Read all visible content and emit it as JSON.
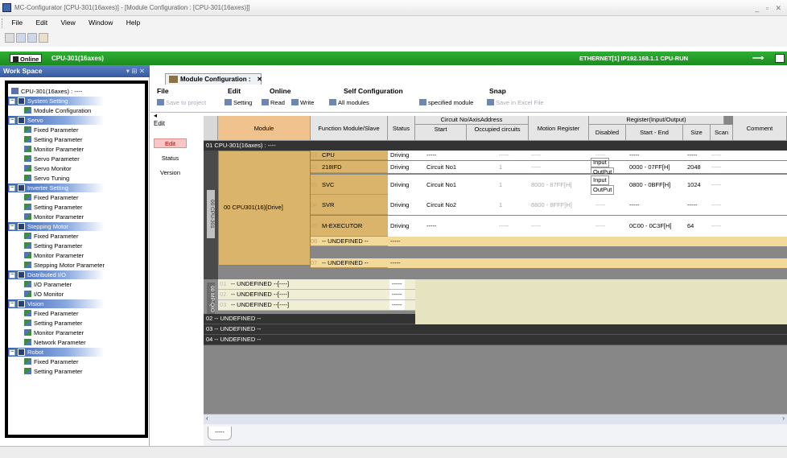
{
  "window": {
    "title": "MC-Configurator [CPU-301(16axes)] - [Module Configuration : [CPU-301(16axes)]]",
    "controls": "_ ▫ ✕"
  },
  "menu": [
    "File",
    "Edit",
    "View",
    "Window",
    "Help"
  ],
  "status_bar": {
    "online_label": "Online",
    "cpu_name": "CPU-301(16axes)",
    "connection": "ETHERNET[1] IP192.168.1.1 CPU-RUN"
  },
  "workspace": {
    "title": "Work Space",
    "pins": "▾ ⊞ ✕",
    "root": "CPU-301(16axes) : ----",
    "sections": [
      {
        "label": "System Setting",
        "items": [
          "Module Configuration"
        ]
      },
      {
        "label": "Servo",
        "items": [
          "Fixed Parameter",
          "Setting Parameter",
          "Monitor Parameter",
          "Servo Parameter",
          "Servo Monitor",
          "Servo Tuning"
        ]
      },
      {
        "label": "Inverter Setting",
        "items": [
          "Fixed Parameter",
          "Setting Parameter",
          "Monitor Parameter"
        ]
      },
      {
        "label": "Stepping Motor",
        "items": [
          "Fixed Parameter",
          "Setting Parameter",
          "Monitor Parameter",
          "Stepping Motor Parameter"
        ]
      },
      {
        "label": "Distributed I/O",
        "items": [
          "I/O Parameter",
          "I/O Monitor"
        ]
      },
      {
        "label": "Vision",
        "items": [
          "Fixed Parameter",
          "Setting Parameter",
          "Monitor Parameter",
          "Network Parameter"
        ]
      },
      {
        "label": "Robot",
        "items": [
          "Fixed Parameter",
          "Setting Parameter"
        ]
      }
    ]
  },
  "tab": {
    "label": "Module Configuration : [CPU-301(16axes)]"
  },
  "ribbon": {
    "groups": [
      {
        "title": "File",
        "buttons": [
          "Save to project"
        ]
      },
      {
        "title": "Edit",
        "buttons": [
          "Setting"
        ]
      },
      {
        "title": "Online",
        "buttons": [
          "Read",
          "Write"
        ]
      },
      {
        "title": "Self Configuration",
        "buttons": [
          "All modules",
          "specified module"
        ]
      },
      {
        "title": "Snap",
        "buttons": [
          "Save in Excel File"
        ]
      }
    ]
  },
  "left_nav": {
    "header": "Edit",
    "items": [
      "Edit",
      "Status",
      "Version"
    ]
  },
  "table": {
    "headers": {
      "module": "Module",
      "function": "Function Module/Slave",
      "status": "Status",
      "circuit": "Circuit No/AxisAddress",
      "circuit_start": "Start",
      "circuit_occupied": "Occupied circuits",
      "motion": "Motion Register",
      "register": "Register(Input/Output)",
      "reg_disabled": "Disabled",
      "reg_startend": "Start - End",
      "reg_size": "Size",
      "reg_scan": "Scan",
      "comment": "Comment"
    },
    "cpu_row": "01 CPU-301(16axes) : ----",
    "slot_vertical": "00 CPU-301",
    "io_vertical": "00 MP-QIO",
    "module_main": "00  CPU301(16)[Drive]",
    "rows": [
      {
        "n": "01",
        "fn": "CPU",
        "status": "Driving",
        "circ": "-----",
        "occ": "-----",
        "motion": "-----",
        "disabled": "-----",
        "se": "-----",
        "size": "-----",
        "scan": "-----"
      },
      {
        "n": "02",
        "fn": "218IFD",
        "status": "Driving",
        "circ": "Circuit No1",
        "occ": "1",
        "motion": "-----",
        "dis_in": "Input",
        "dis_out": "OutPut",
        "se": "0000 - 07FF[H]",
        "size": "2048",
        "scan": "-----"
      },
      {
        "n": "03",
        "fn": "SVC",
        "status": "Driving",
        "circ": "Circuit No1",
        "occ": "1",
        "motion": "8000 - 87FF[H]",
        "dis_in": "Input",
        "dis_out": "OutPut",
        "se": "0800 - 0BFF[H]",
        "size": "1024",
        "scan": "-----"
      },
      {
        "n": "04",
        "fn": "SVR",
        "status": "Driving",
        "circ": "Circuit No2",
        "occ": "1",
        "motion": "8800 - 8FFF[H]",
        "disabled": "-----",
        "se": "-----",
        "size": "-----",
        "scan": "-----"
      },
      {
        "n": "05",
        "fn": "M-EXECUTOR",
        "status": "Driving",
        "circ": "-----",
        "occ": "-----",
        "motion": "-----",
        "disabled": "-----",
        "se": "0C00 - 0C3F[H]",
        "size": "64",
        "scan": "-----"
      },
      {
        "n": "06",
        "fn": "-- UNDEFINED --",
        "status": "-----"
      },
      {
        "n": "07",
        "fn": "-- UNDEFINED --",
        "status": "-----"
      }
    ],
    "io_rows": [
      {
        "n": "01",
        "label": "-- UNDEFINED --[----]",
        "status": "-----"
      },
      {
        "n": "02",
        "label": "-- UNDEFINED --[----]",
        "status": "-----"
      },
      {
        "n": "03",
        "label": "-- UNDEFINED --[----]",
        "status": "-----"
      }
    ],
    "empty_rows": [
      "02 -- UNDEFINED --",
      "03 -- UNDEFINED --",
      "04 -- UNDEFINED --"
    ]
  },
  "bottom_tab": "-----",
  "colors": {
    "green": "#1b8c1f",
    "module_tan": "#d9b46a",
    "accent_blue": "#35599d"
  }
}
